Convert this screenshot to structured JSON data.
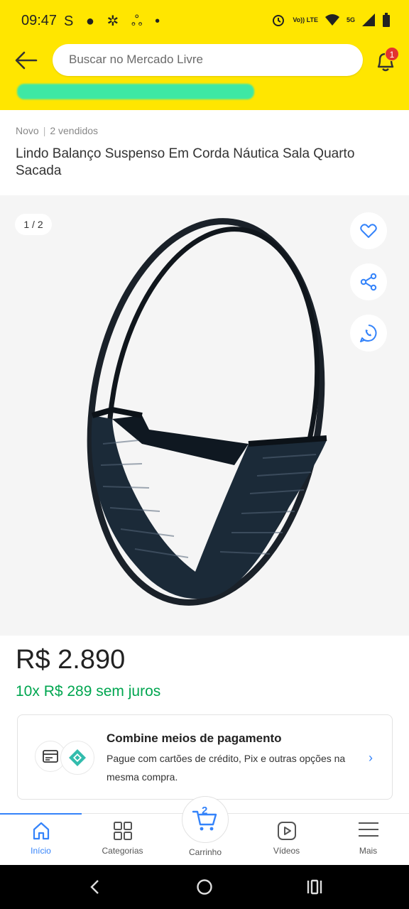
{
  "status_bar": {
    "time": "09:47",
    "left_icons": "S ● ✲ ஃ •",
    "lte_label": "Vo)) LTE",
    "signal_label": "5G"
  },
  "header": {
    "back_icon": "arrow-left-icon",
    "search_placeholder": "Buscar no Mercado Livre",
    "notification_count": "1",
    "accent_color": "#ffe600"
  },
  "product": {
    "condition": "Novo",
    "sold": "2 vendidos",
    "title": "Lindo Balanço Suspenso Em Corda Náutica  Sala Quarto Sacada",
    "image_counter": "1 / 2",
    "price": "R$ 2.890",
    "installments": "10x R$ 289 sem juros"
  },
  "payment": {
    "title": "Combine meios de pagamento",
    "description": "Pague com cartões de crédito, Pix e outras opções na mesma compra."
  },
  "bottom_nav": {
    "items": [
      {
        "label": "Início",
        "icon": "home-icon",
        "active": true
      },
      {
        "label": "Categorias",
        "icon": "grid-icon",
        "active": false
      },
      {
        "label": "Carrinho",
        "icon": "cart-icon",
        "active": false,
        "count": "2"
      },
      {
        "label": "Vídeos",
        "icon": "play-icon",
        "active": false
      },
      {
        "label": "Mais",
        "icon": "menu-icon",
        "active": false
      }
    ]
  },
  "colors": {
    "link_blue": "#3483fa",
    "green": "#00a650",
    "badge_red": "#e3342f"
  }
}
